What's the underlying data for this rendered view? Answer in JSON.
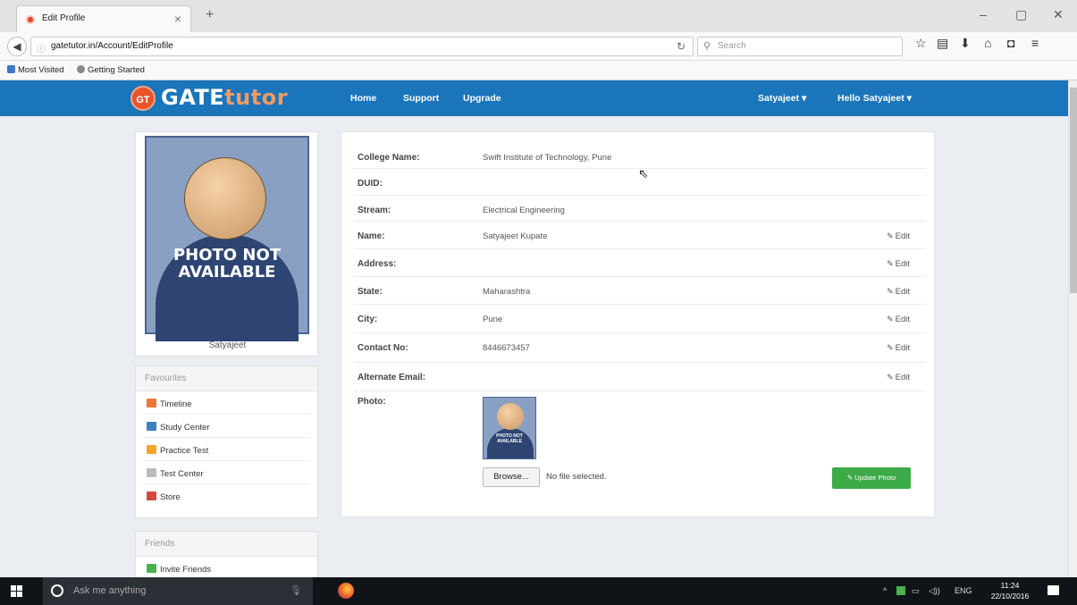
{
  "browser": {
    "tab_title": "Edit Profile",
    "tab_close": "×",
    "new_tab": "+",
    "url": "gatetutor.in/Account/EditProfile",
    "search_placeholder": "Search",
    "window_controls": [
      "–",
      "▢",
      "✕"
    ],
    "bookmarks": [
      "Most Visited",
      "Getting Started"
    ]
  },
  "site": {
    "logo_badge": "GT",
    "logo_main": "GATE",
    "logo_accent": "tutor",
    "nav": [
      "Home",
      "Support",
      "Upgrade"
    ],
    "user_menu": "Satyajeet ▾",
    "hello_menu": "Hello Satyajeet ▾",
    "brand_color": "#1b75bb"
  },
  "sidebar": {
    "photo_text": "PHOTO NOT AVAILABLE",
    "profile_name": "Satyajeet",
    "favourites_title": "Favourites",
    "favourites": [
      {
        "label": "Timeline",
        "icon": "timeline-icon",
        "color": "#e87a3a"
      },
      {
        "label": "Study Center",
        "icon": "study-center-icon",
        "color": "#3d7fc0"
      },
      {
        "label": "Practice Test",
        "icon": "practice-test-icon",
        "color": "#f2a531"
      },
      {
        "label": "Test Center",
        "icon": "test-center-icon",
        "color": "#bbbbbb"
      },
      {
        "label": "Store",
        "icon": "store-icon",
        "color": "#d14a3b"
      }
    ],
    "friends_title": "Friends",
    "friends": [
      {
        "label": "Invite Friends",
        "icon": "invite-friends-icon",
        "color": "#4caf50"
      }
    ]
  },
  "profile": {
    "rows": [
      {
        "label": "College Name:",
        "value": "Swift Institute of Technology, Pune",
        "editable": false
      },
      {
        "label": "DUID:",
        "value": "",
        "editable": false
      },
      {
        "label": "Stream:",
        "value": "Electrical Engineering",
        "editable": false
      },
      {
        "label": "Name:",
        "value": "Satyajeet Kupate",
        "editable": true
      },
      {
        "label": "Address:",
        "value": "",
        "editable": true
      },
      {
        "label": "State:",
        "value": "Maharashtra",
        "editable": true
      },
      {
        "label": "City:",
        "value": "Pune",
        "editable": true
      },
      {
        "label": "Contact No:",
        "value": "8446673457",
        "editable": true
      },
      {
        "label": "Alternate Email:",
        "value": "",
        "editable": true
      }
    ],
    "edit_label": "Edit",
    "photo_label": "Photo:",
    "thumb_text": "PHOTO NOT AVAILABLE",
    "browse_label": "Browse...",
    "file_status": "No file selected.",
    "update_photo_label": "Update Photo"
  },
  "taskbar": {
    "cortana_placeholder": "Ask me anything",
    "language": "ENG",
    "time": "11:24",
    "date": "22/10/2016"
  }
}
